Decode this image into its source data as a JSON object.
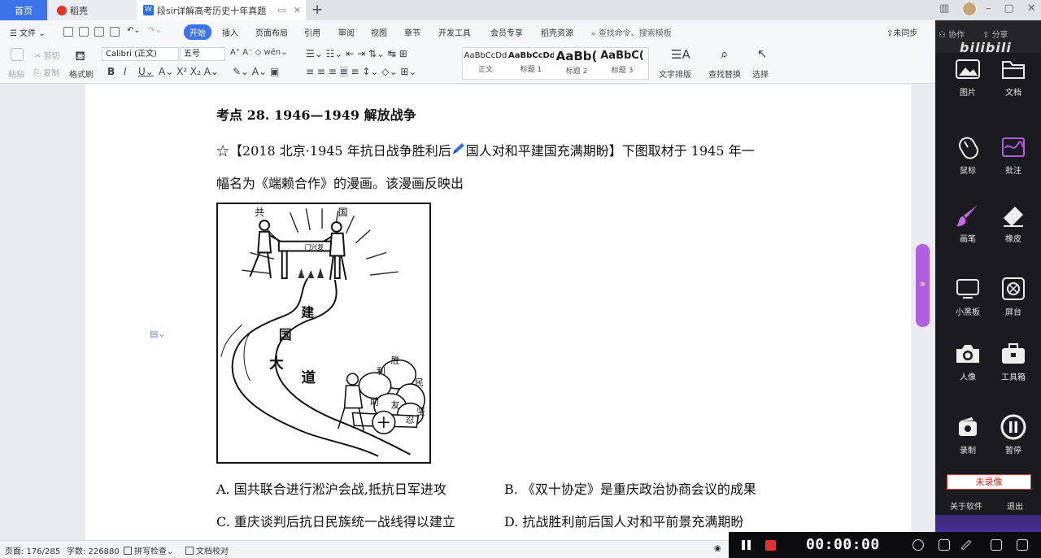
{
  "tabs": {
    "home": "首页",
    "daoke": "稻壳",
    "document": "段sir详解高考历史十年真题",
    "add": "+"
  },
  "menu": {
    "file": "文件",
    "start": "开始",
    "insert": "插入",
    "layout": "页面布局",
    "reference": "引用",
    "review": "审阅",
    "view": "视图",
    "chapter": "章节",
    "devtools": "开发工具",
    "member": "会员专享",
    "daoke_res": "稻壳资源",
    "search": "查找命令、搜索模板",
    "unsync": "未同步",
    "collab": "协作",
    "share": "分享"
  },
  "ribbon": {
    "paste": "粘贴",
    "cut": "剪切",
    "copy": "复制",
    "format_painter": "格式刷",
    "font_name": "Calibri (正文)",
    "font_size": "五号",
    "styles": [
      {
        "sample": "AaBbCcDd",
        "label": "正文"
      },
      {
        "sample": "AaBbCcDd",
        "label": "标题 1"
      },
      {
        "sample": "AaBb(",
        "label": "标题 2"
      },
      {
        "sample": "AaBbC(",
        "label": "标题 3"
      }
    ],
    "text_layout": "文字排版",
    "find_replace": "查找替换",
    "select": "选择"
  },
  "document": {
    "heading": "考点 28. 1946—1949 解放战争",
    "question_line1_a": "☆【2018 北京·1945 年抗日战争胜利后",
    "question_line1_b": "国人对和平建国充满期盼】下图取材于 1945 年一",
    "question_line2": "幅名为《端赖合作》的漫画。该漫画反映出",
    "cartoon_labels": {
      "top_left": "共",
      "top_right": "国",
      "gate": "门兴复",
      "road1": "建",
      "road2": "国",
      "road3": "大",
      "road4": "道",
      "cart1": "胜",
      "cart2": "利",
      "cart3": "民",
      "cart4": "助",
      "cart5": "友",
      "cart6": "忍",
      "cart7": "坚"
    },
    "options": {
      "a": "A. 国共联合进行淞沪会战,抵抗日军进攻",
      "b": "B. 《双十协定》是重庆政治协商会议的成果",
      "c": "C. 重庆谈判后抗日民族统一战线得以建立",
      "d": "D. 抗战胜利前后国人对和平前景充满期盼"
    }
  },
  "right_panel": {
    "items": [
      {
        "label": "图片",
        "icon": "image-icon"
      },
      {
        "label": "文档",
        "icon": "folder-icon"
      },
      {
        "label": "鼠标",
        "icon": "mouse-icon"
      },
      {
        "label": "批注",
        "icon": "annotate-icon"
      },
      {
        "label": "画笔",
        "icon": "brush-icon"
      },
      {
        "label": "橡皮",
        "icon": "eraser-icon"
      },
      {
        "label": "小黑板",
        "icon": "blackboard-icon"
      },
      {
        "label": "屏台",
        "icon": "shutter-icon"
      },
      {
        "label": "人像",
        "icon": "camera-icon"
      },
      {
        "label": "工具箱",
        "icon": "toolbox-icon"
      },
      {
        "label": "录制",
        "icon": "record-icon"
      },
      {
        "label": "暂停",
        "icon": "pause-icon"
      }
    ],
    "not_recording": "未录像",
    "about": "关于软件",
    "exit": "退出",
    "brand": "bilibili"
  },
  "status": {
    "page": "页面: 176/285",
    "words": "字数: 226880",
    "spell": "拼写检查",
    "proof": "文档校对"
  },
  "recorder": {
    "time": "00:00:00"
  },
  "colors": {
    "accent_blue": "#3d74ea",
    "purple": "#b25ee0",
    "record_red": "#e03030"
  }
}
